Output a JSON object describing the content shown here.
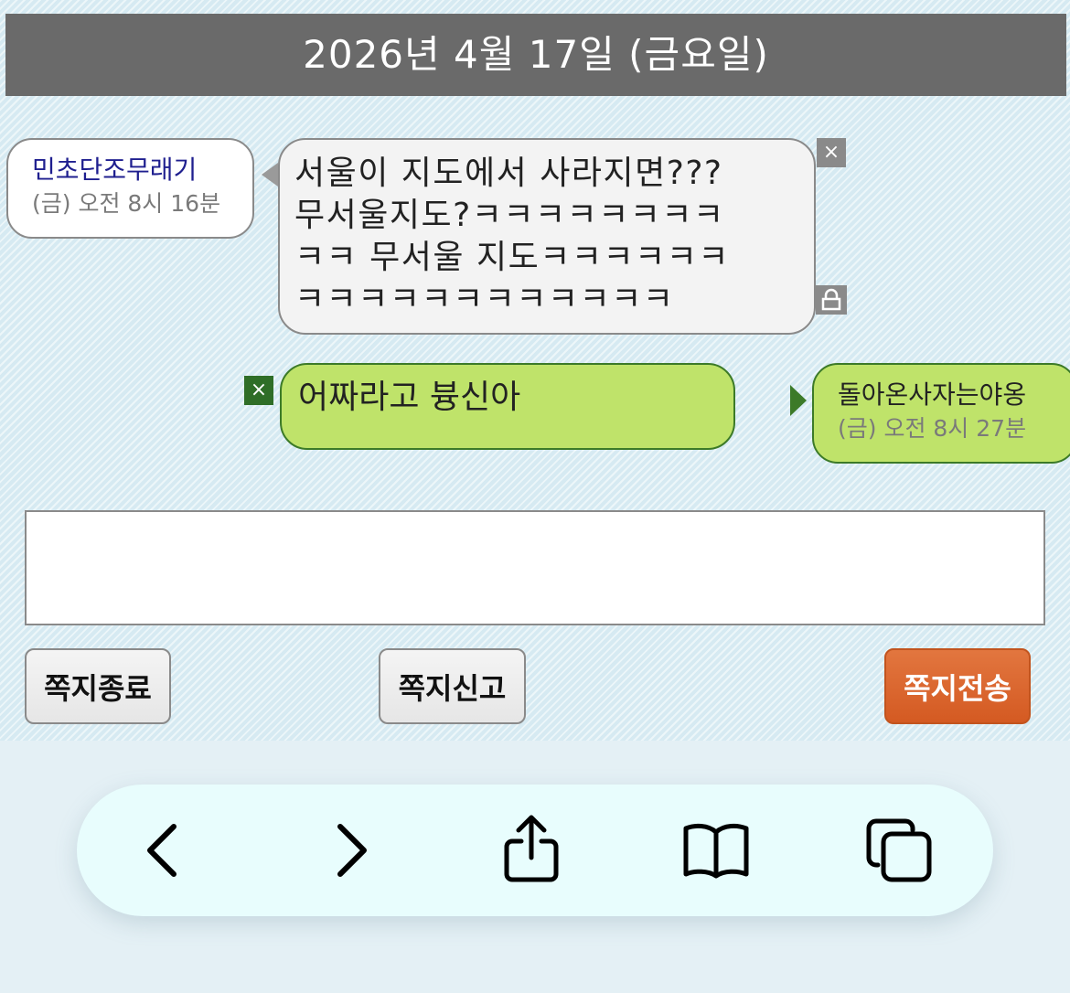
{
  "header": {
    "date": "2026년 4월 17일 (금요일)"
  },
  "messages": {
    "received": {
      "sender": "민초단조무래기",
      "time": "(금) 오전 8시 16분",
      "text": "서울이 지도에서 사라지면???\n무서울지도?ㅋㅋㅋㅋㅋㅋㅋㅋ\nㅋㅋ 무서울 지도ㅋㅋㅋㅋㅋㅋ\nㅋㅋㅋㅋㅋㅋㅋㅋㅋㅋㅋㅋ",
      "delete_label": "×"
    },
    "sent": {
      "sender": "돌아온사자는야옹",
      "time": "(금) 오전 8시 27분",
      "text": "어짜라고 븅신아",
      "delete_label": "×"
    }
  },
  "compose": {
    "value": "",
    "placeholder": ""
  },
  "buttons": {
    "exit_label": "쪽지종료",
    "report_label": "쪽지신고",
    "send_label": "쪽지전송"
  },
  "browser_toolbar": {
    "icons": [
      "chevron-left-icon",
      "chevron-right-icon",
      "share-icon",
      "book-icon",
      "tabs-icon"
    ]
  },
  "colors": {
    "date_bar": "#6a6a6a",
    "received_bubble": "#f3f3f3",
    "sent_bubble": "#bfe36a",
    "sent_border": "#3c7a28",
    "send_button": "#d45a22",
    "sender_name_received": "#1f1f8f"
  }
}
